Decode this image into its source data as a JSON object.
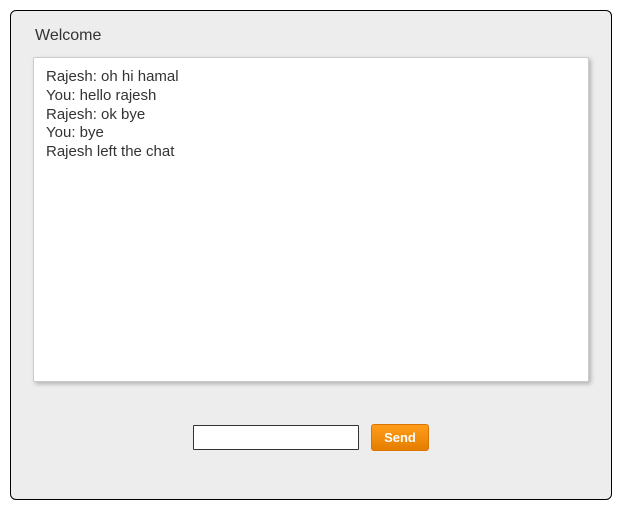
{
  "header": {
    "welcome": "Welcome"
  },
  "chat": {
    "messages": [
      "Rajesh: oh hi hamal",
      "You: hello rajesh",
      "Rajesh: ok bye",
      "You: bye",
      "Rajesh left the chat"
    ]
  },
  "input": {
    "value": "",
    "placeholder": ""
  },
  "buttons": {
    "send": "Send"
  }
}
